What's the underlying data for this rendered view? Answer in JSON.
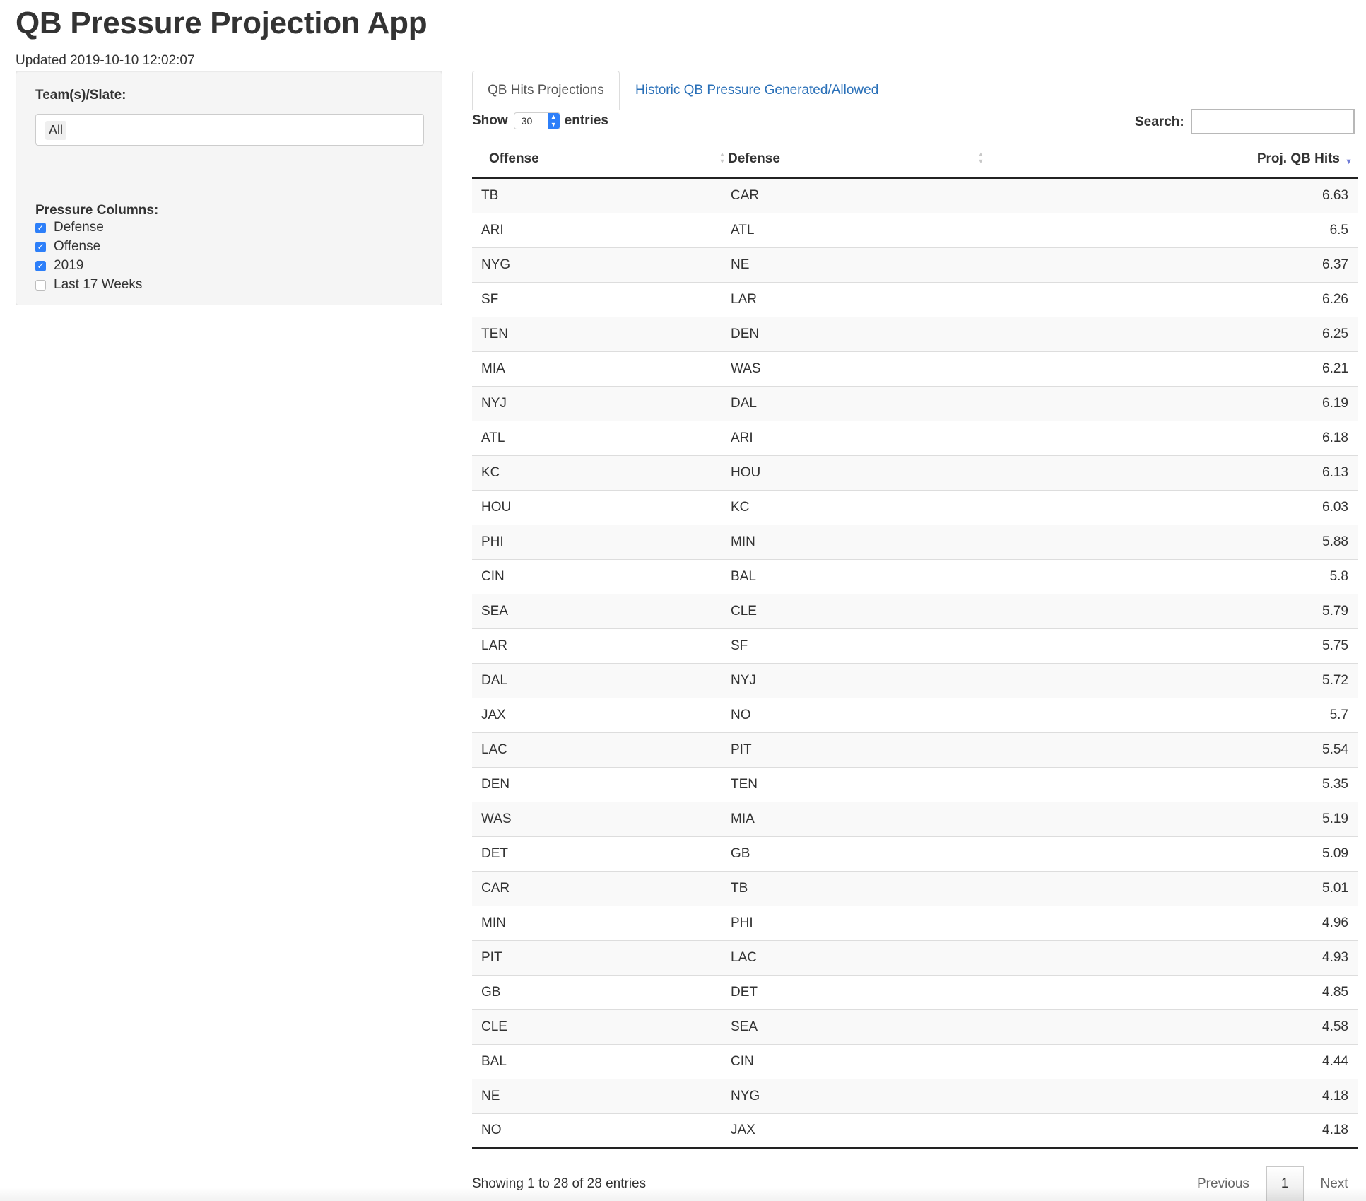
{
  "app": {
    "title": "QB Pressure Projection App",
    "updated": "Updated 2019-10-10 12:02:07"
  },
  "sidebar": {
    "slate_label": "Team(s)/Slate:",
    "slate_value": "All",
    "columns_label": "Pressure Columns:",
    "checkboxes": [
      {
        "label": "Defense",
        "checked": true
      },
      {
        "label": "Offense",
        "checked": true
      },
      {
        "label": "2019",
        "checked": true
      },
      {
        "label": "Last 17 Weeks",
        "checked": false
      }
    ]
  },
  "tabs": [
    {
      "label": "QB Hits Projections",
      "active": true
    },
    {
      "label": "Historic QB Pressure Generated/Allowed",
      "active": false
    }
  ],
  "table_controls": {
    "show_label": "Show",
    "entries_value": "30",
    "entries_label": "entries",
    "search_label": "Search:",
    "search_value": ""
  },
  "table": {
    "columns": [
      "Offense",
      "Defense",
      "Proj. QB Hits"
    ],
    "rows": [
      [
        "TB",
        "CAR",
        "6.63"
      ],
      [
        "ARI",
        "ATL",
        "6.5"
      ],
      [
        "NYG",
        "NE",
        "6.37"
      ],
      [
        "SF",
        "LAR",
        "6.26"
      ],
      [
        "TEN",
        "DEN",
        "6.25"
      ],
      [
        "MIA",
        "WAS",
        "6.21"
      ],
      [
        "NYJ",
        "DAL",
        "6.19"
      ],
      [
        "ATL",
        "ARI",
        "6.18"
      ],
      [
        "KC",
        "HOU",
        "6.13"
      ],
      [
        "HOU",
        "KC",
        "6.03"
      ],
      [
        "PHI",
        "MIN",
        "5.88"
      ],
      [
        "CIN",
        "BAL",
        "5.8"
      ],
      [
        "SEA",
        "CLE",
        "5.79"
      ],
      [
        "LAR",
        "SF",
        "5.75"
      ],
      [
        "DAL",
        "NYJ",
        "5.72"
      ],
      [
        "JAX",
        "NO",
        "5.7"
      ],
      [
        "LAC",
        "PIT",
        "5.54"
      ],
      [
        "DEN",
        "TEN",
        "5.35"
      ],
      [
        "WAS",
        "MIA",
        "5.19"
      ],
      [
        "DET",
        "GB",
        "5.09"
      ],
      [
        "CAR",
        "TB",
        "5.01"
      ],
      [
        "MIN",
        "PHI",
        "4.96"
      ],
      [
        "PIT",
        "LAC",
        "4.93"
      ],
      [
        "GB",
        "DET",
        "4.85"
      ],
      [
        "CLE",
        "SEA",
        "4.58"
      ],
      [
        "BAL",
        "CIN",
        "4.44"
      ],
      [
        "NE",
        "NYG",
        "4.18"
      ],
      [
        "NO",
        "JAX",
        "4.18"
      ]
    ],
    "info": "Showing 1 to 28 of 28 entries"
  },
  "pagination": {
    "previous": "Previous",
    "current": "1",
    "next": "Next"
  },
  "colors": {
    "accent": "#2d7ff9",
    "link": "#2a70b8",
    "sort_active": "#6f7bd6"
  }
}
